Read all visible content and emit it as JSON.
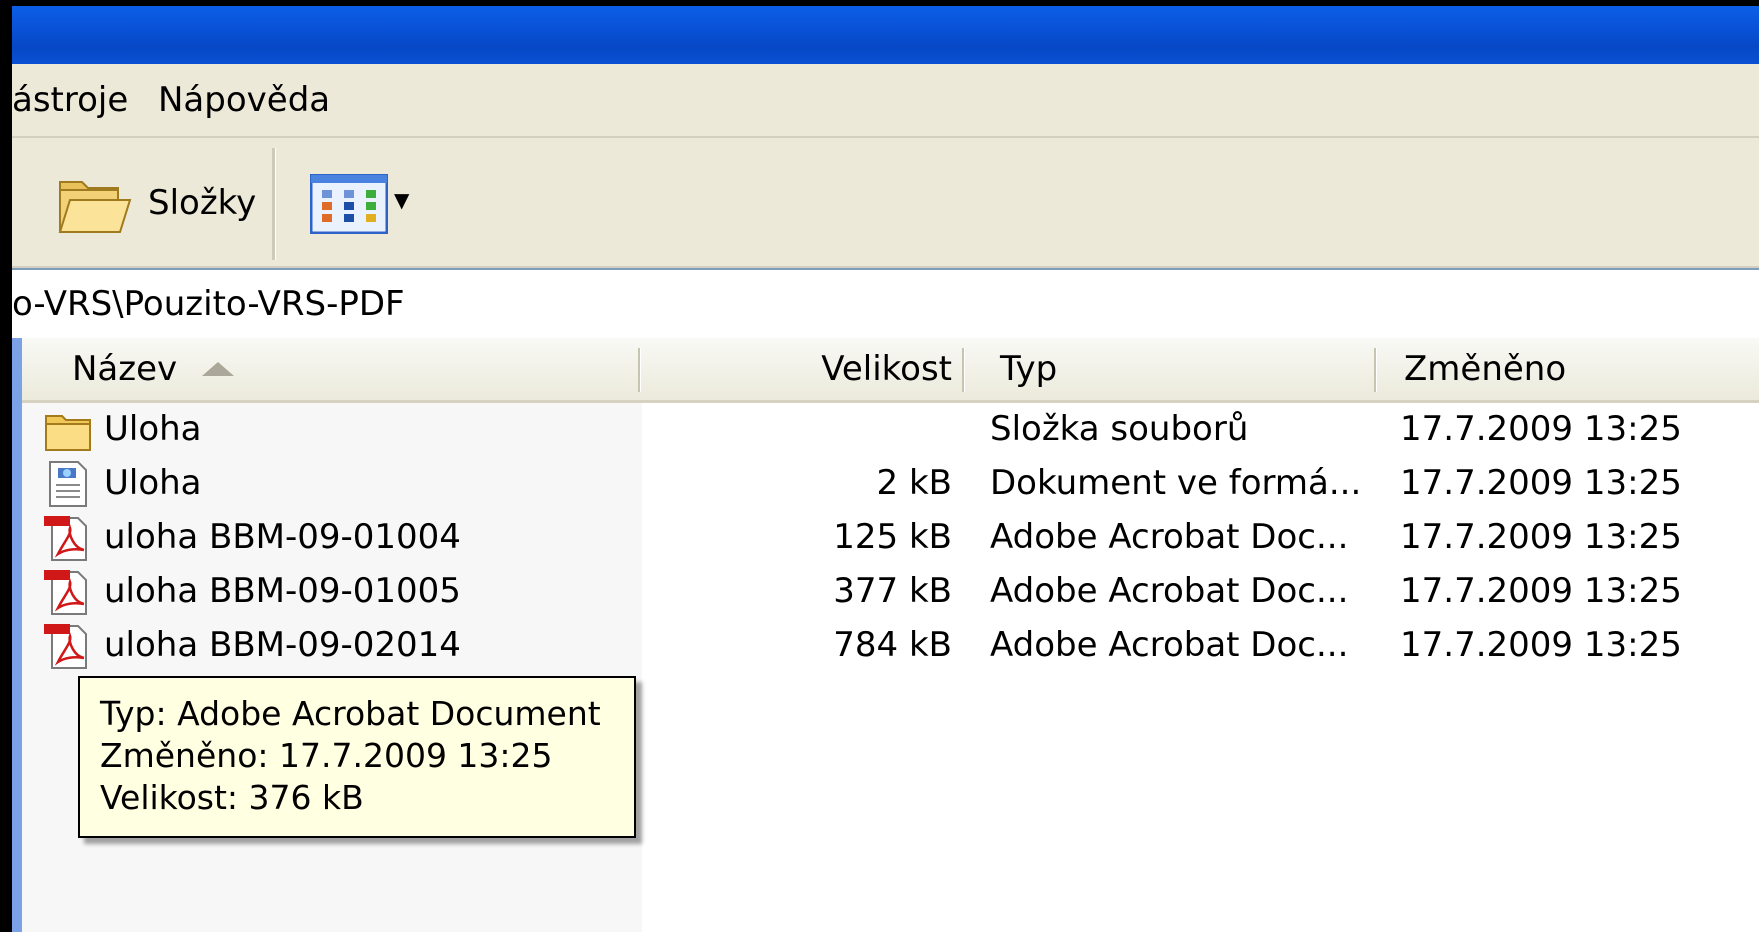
{
  "menu": {
    "items": [
      "ástroje",
      "Nápověda"
    ]
  },
  "toolbar": {
    "folders_label": "Složky",
    "folders_icon": "folder-icon",
    "views_icon": "views-icon"
  },
  "address": {
    "path": "o-VRS\\Pouzito-VRS-PDF"
  },
  "columns": {
    "name": "Název",
    "size": "Velikost",
    "type": "Typ",
    "modified": "Změněno"
  },
  "files": [
    {
      "icon": "folder-icon",
      "name": "Uloha",
      "size": "",
      "type": "Složka souborů",
      "modified": "17.7.2009 13:25"
    },
    {
      "icon": "document-icon",
      "name": "Uloha",
      "size": "2 kB",
      "type": "Dokument ve formá...",
      "modified": "17.7.2009 13:25"
    },
    {
      "icon": "pdf-icon",
      "name": "uloha BBM-09-01004",
      "size": "125 kB",
      "type": "Adobe Acrobat Doc...",
      "modified": "17.7.2009 13:25"
    },
    {
      "icon": "pdf-icon",
      "name": "uloha BBM-09-01005",
      "size": "377 kB",
      "type": "Adobe Acrobat Doc...",
      "modified": "17.7.2009 13:25"
    },
    {
      "icon": "pdf-icon",
      "name": "uloha BBM-09-02014",
      "size": "784 kB",
      "type": "Adobe Acrobat Doc...",
      "modified": "17.7.2009 13:25"
    }
  ],
  "tooltip": {
    "line1": "Typ: Adobe Acrobat Document",
    "line2": "Změněno: 17.7.2009 13:25",
    "line3": "Velikost: 376 kB"
  },
  "colors": {
    "titlebar": "#0a53d9",
    "chrome": "#ece9d8",
    "tooltip_bg": "#ffffe1",
    "selection_edge": "#7ba2e7"
  }
}
